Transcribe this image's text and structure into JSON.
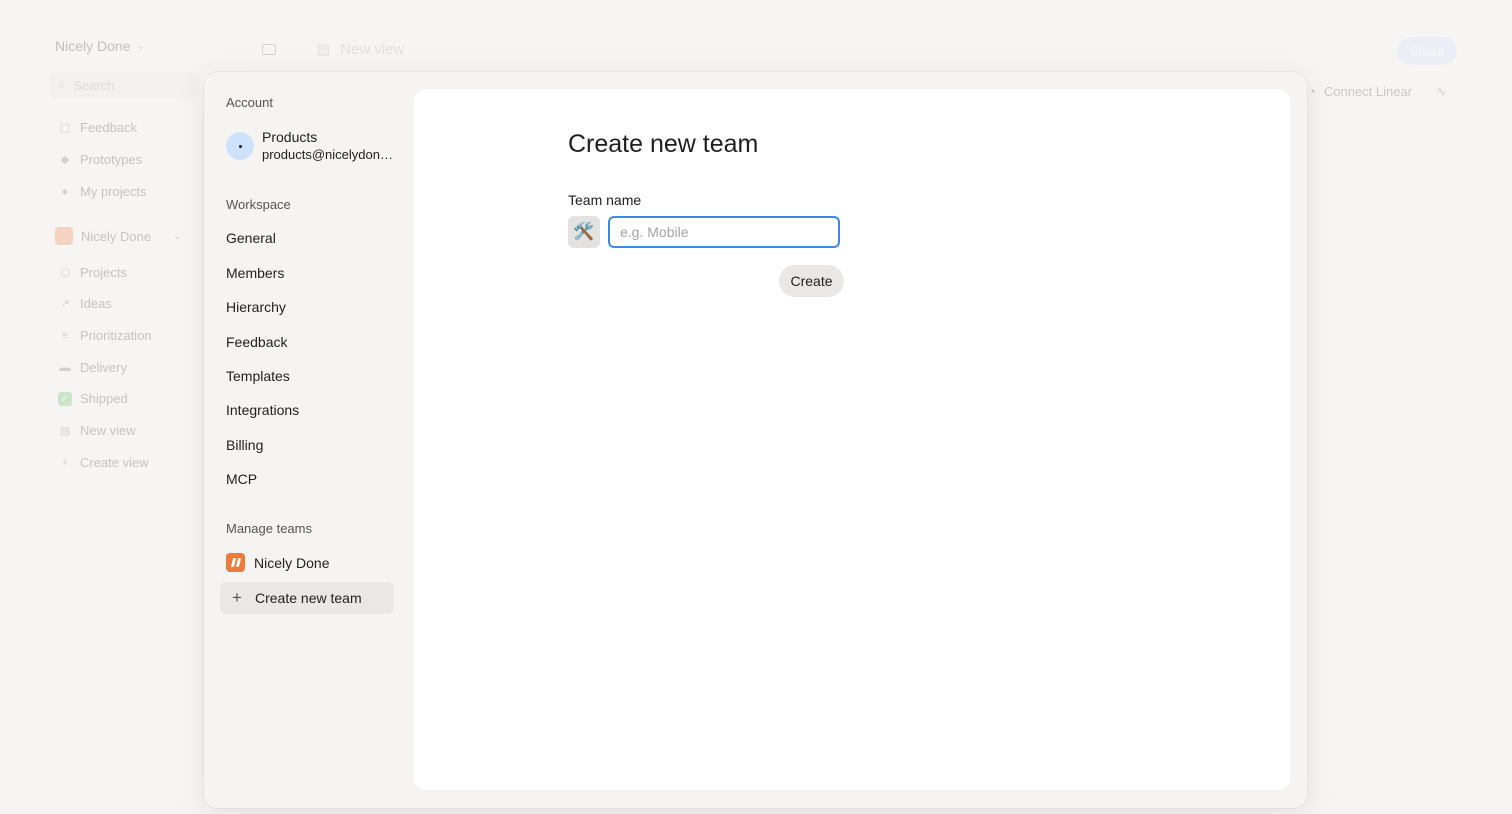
{
  "background": {
    "workspace_name": "Nicely Done",
    "search_placeholder": "Search",
    "nav": [
      {
        "label": "Feedback",
        "icon": "feedback-icon"
      },
      {
        "label": "Prototypes",
        "icon": "prototype-icon"
      },
      {
        "label": "My projects",
        "icon": "user-icon"
      }
    ],
    "team_name": "Nicely Done",
    "team_nav": [
      {
        "label": "Projects",
        "icon": "box-icon"
      },
      {
        "label": "Ideas",
        "icon": "trend-icon"
      },
      {
        "label": "Prioritization",
        "icon": "sliders-icon"
      },
      {
        "label": "Delivery",
        "icon": "truck-icon"
      },
      {
        "label": "Shipped",
        "icon": "check-icon"
      },
      {
        "label": "New view",
        "icon": "calendar-icon"
      },
      {
        "label": "Create view",
        "icon": "plus-icon"
      }
    ],
    "header_view_title": "New view",
    "share_label": "Share",
    "connect_linear_label": "Connect Linear"
  },
  "settings": {
    "account_heading": "Account",
    "account_name": "Products",
    "account_email": "products@nicelydone.club",
    "workspace_heading": "Workspace",
    "workspace_items": [
      "General",
      "Members",
      "Hierarchy",
      "Feedback",
      "Templates",
      "Integrations",
      "Billing",
      "MCP"
    ],
    "manage_teams_heading": "Manage teams",
    "team_name": "Nicely Done",
    "create_team_label": "Create new team"
  },
  "form": {
    "title": "Create new team",
    "team_name_label": "Team name",
    "team_emoji": "🛠️",
    "team_name_placeholder": "e.g. Mobile",
    "team_name_value": "",
    "create_button_label": "Create"
  },
  "colors": {
    "accent": "#3d8ae6",
    "team_badge": "#ee7a3b",
    "avatar_bg": "#cfe2fb"
  }
}
